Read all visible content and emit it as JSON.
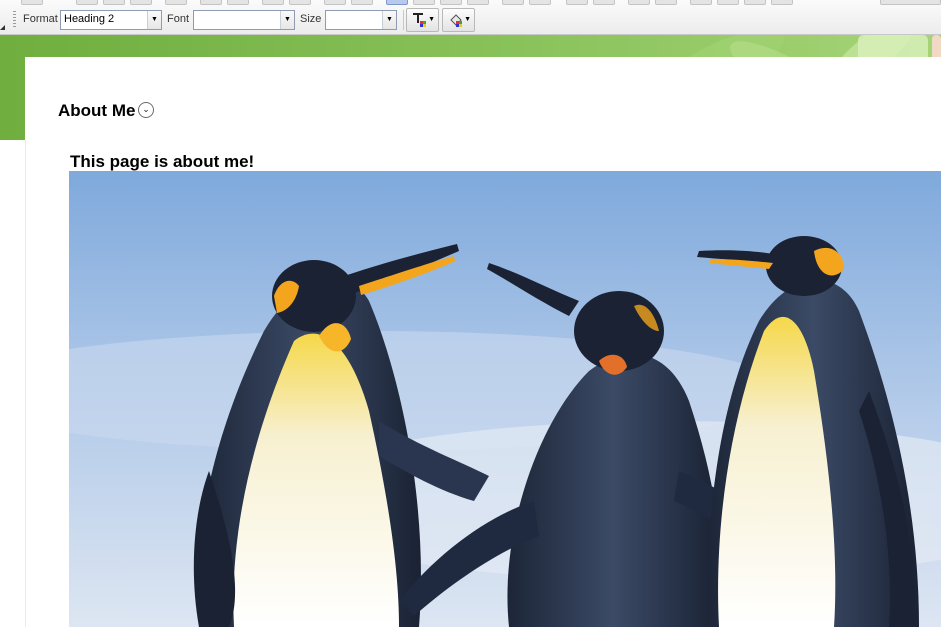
{
  "toolbar": {
    "format_label": "Format",
    "format_value": "Heading 2",
    "font_label": "Font",
    "font_value": "",
    "size_label": "Size",
    "size_value": ""
  },
  "page": {
    "title": "About Me",
    "heading": "This page is about me!"
  },
  "icons": {
    "title_menu": "chevron-down-icon",
    "text_color": "text-color-icon",
    "background_color": "background-color-icon",
    "combo_arrow": "dropdown-arrow-icon"
  },
  "colors": {
    "banner_green": "#7cb84b",
    "page_bg": "#ffffff",
    "sky": "#8fb3de"
  }
}
